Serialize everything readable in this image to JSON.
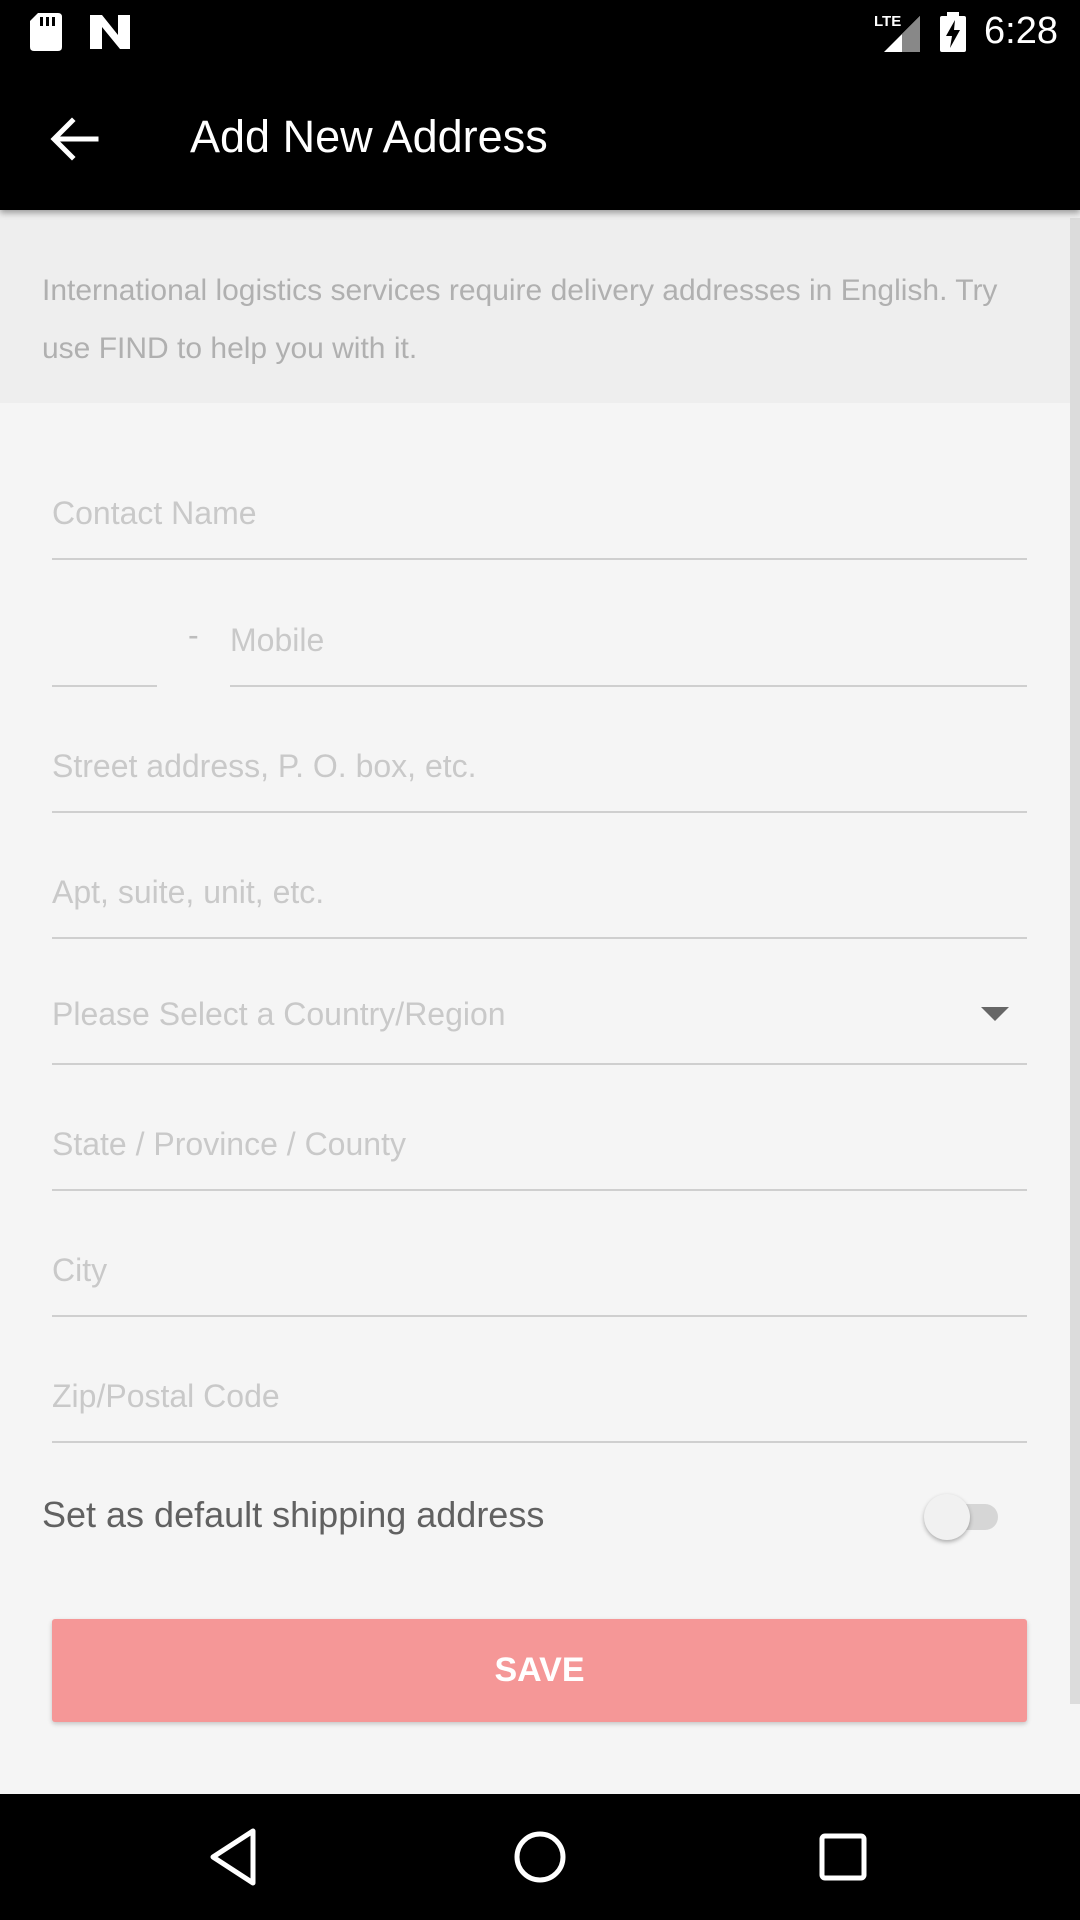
{
  "status_bar": {
    "time": "6:28",
    "network": "LTE",
    "icons": [
      "sd-card-icon",
      "n-notification-icon",
      "signal-icon",
      "battery-charging-icon"
    ]
  },
  "app_bar": {
    "title": "Add New Address",
    "back_icon": "arrow-back-icon"
  },
  "notice": {
    "text": "International logistics services require delivery addresses in English. Try use FIND to help you with it."
  },
  "form": {
    "contact_name": {
      "placeholder": "Contact Name",
      "value": ""
    },
    "phone_code": {
      "placeholder": "",
      "value": ""
    },
    "dash": "-",
    "mobile": {
      "placeholder": "Mobile",
      "value": ""
    },
    "street": {
      "placeholder": "Street address, P. O. box, etc.",
      "value": ""
    },
    "apt": {
      "placeholder": "Apt, suite, unit, etc.",
      "value": ""
    },
    "country": {
      "placeholder": "Please Select a Country/Region"
    },
    "state": {
      "placeholder": "State / Province / County",
      "value": ""
    },
    "city": {
      "placeholder": "City",
      "value": ""
    },
    "zip": {
      "placeholder": "Zip/Postal Code",
      "value": ""
    },
    "default_label": "Set as default shipping address",
    "default_enabled": false,
    "save_label": "SAVE"
  },
  "colors": {
    "save_button": "#f59797",
    "bars": "#000000"
  },
  "nav_bar": {
    "icons": [
      "back-triangle-icon",
      "home-circle-icon",
      "recents-square-icon"
    ]
  }
}
